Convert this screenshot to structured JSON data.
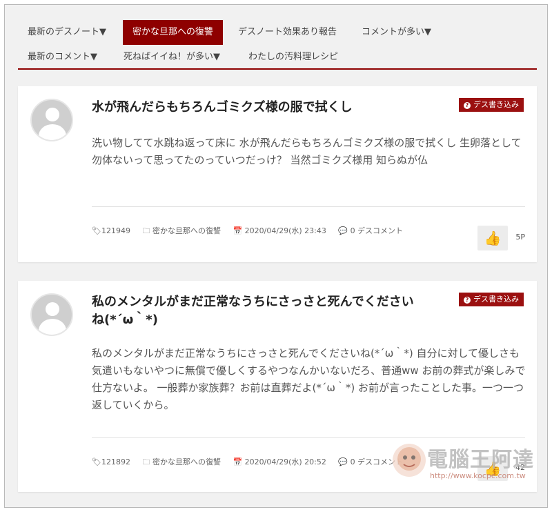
{
  "nav": {
    "items": [
      {
        "label": "最新のデスノート▼"
      },
      {
        "label": "密かな旦那への復讐",
        "active": true
      },
      {
        "label": "デスノート効果あり報告"
      },
      {
        "label": "コメントが多い▼"
      },
      {
        "label": "最新のコメント▼"
      },
      {
        "label": "死ねばイイね！が多い▼"
      },
      {
        "label": "わたしの汚料理レシピ"
      }
    ]
  },
  "posts": [
    {
      "title": "水が飛んだらもちろんゴミクズ様の服で拭くし",
      "badge": "デス書き込み",
      "body": "洗い物してて水跳ね返って床に 水が飛んだらもちろんゴミクズ様の服で拭くし 生卵落として 勿体ないって思ってたのっていつだっけ？ 当然ゴミクズ様用 知らぬが仏",
      "id": "121949",
      "category": "密かな旦那への復讐",
      "date": "2020/04/29(水) 23:43",
      "comments": "0 デスコメント",
      "likes": "5P"
    },
    {
      "title": "私のメンタルがまだ正常なうちにさっさと死んでくださいね(*´ω｀*)",
      "badge": "デス書き込み",
      "body": "私のメンタルがまだ正常なうちにさっさと死んでくださいね(*´ω｀*) 自分に対して優しさも気遣いもないやつに無償で優しくするやつなんかいないだろ、普通ww お前の葬式が楽しみで仕方ないよ。 一般葬か家族葬？お前は直葬だよ(*´ω｀*) お前が言ったことした事。一つ一つ返していくから。",
      "id": "121892",
      "category": "密かな旦那への復讐",
      "date": "2020/04/29(水) 20:52",
      "comments": "0 デスコメント",
      "likes": "42"
    }
  ],
  "watermark": {
    "brand": "電腦王阿達",
    "url": "http://www.kocpc.com.tw"
  },
  "colors": {
    "accent": "#8e0000",
    "badge": "#9b1010"
  }
}
